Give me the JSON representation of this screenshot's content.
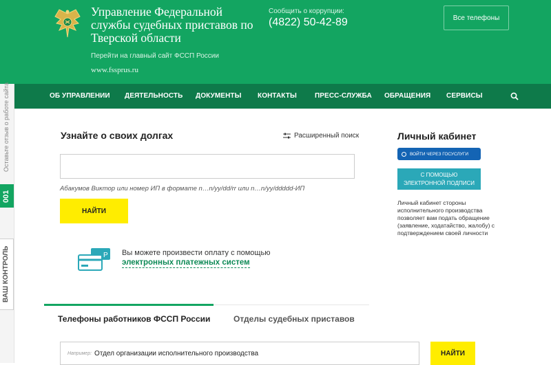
{
  "header": {
    "org_title": "Управление Федеральной службы судебных приставов по Тверской области",
    "main_site_link": "Перейти на главный сайт ФССП России",
    "site_url": "www.fssprus.ru",
    "corruption_label": "Сообщить о коррупции:",
    "corruption_phone": "(4822) 50-42-89",
    "all_phones_label": "Все телефоны"
  },
  "nav": {
    "items": [
      "ОБ УПРАВЛЕНИИ",
      "ДЕЯТЕЛЬНОСТЬ",
      "ДОКУМЕНТЫ",
      "КОНТАКТЫ",
      "ПРЕСС-СЛУЖБА",
      "ОБРАЩЕНИЯ",
      "СЕРВИСЫ"
    ],
    "search_icon": "search-icon"
  },
  "sidebar": {
    "feedback": "Оставьте отзыв о работе сайта",
    "number": "001",
    "control": "ВАШ КОНТРОЛЬ"
  },
  "debt": {
    "title": "Узнайте о своих долгах",
    "advanced_search": "Расширенный поиск",
    "input_value": "",
    "example": "Абакумов Виктор или номер ИП в формате n…n/yy/dd/rr или n…n/yy/ddddd-ИП",
    "find_label": "НАЙТИ"
  },
  "payment": {
    "text": "Вы можете произвести оплату с помощью",
    "link": "электронных платежных систем"
  },
  "tabs": {
    "tab1": "Телефоны работников ФССП России",
    "tab2": "Отделы судебных приставов"
  },
  "department": {
    "hint": "Например:",
    "value": "Отдел организации исполнительного производства",
    "find_label": "НАЙТИ"
  },
  "cabinet": {
    "title": "Личный кабинет",
    "gosuslugi": "ВОЙТИ ЧЕРЕЗ ГОСУСЛУГИ",
    "signature_line1": "С ПОМОЩЬЮ",
    "signature_line2": "ЭЛЕКТРОННОЙ ПОДПИСИ",
    "description": "Личный кабинет стороны исполнительного производства позволяет вам подать обращение (заявление, ходатайство, жалобу) с подтверждением своей личности"
  },
  "colors": {
    "header_green": "#13a561",
    "nav_green": "#0e7a4a",
    "accent_yellow": "#ffed00",
    "gosuslugi_blue": "#1464b4",
    "signature_teal": "#2ba8b8"
  }
}
